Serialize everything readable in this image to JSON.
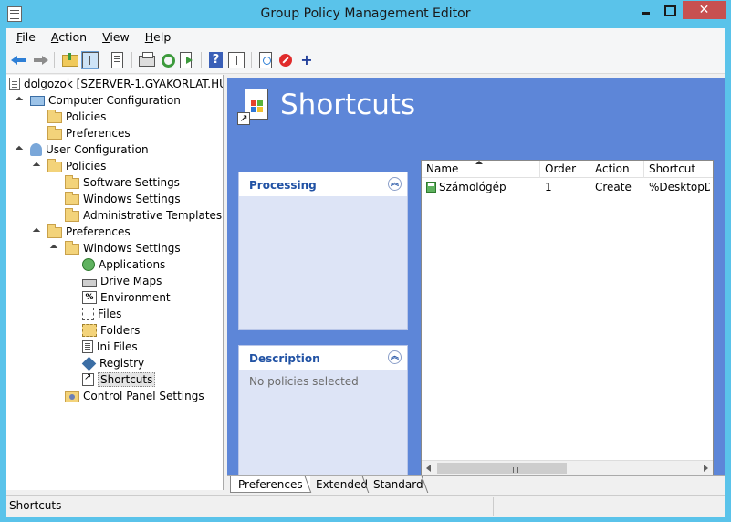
{
  "window": {
    "title": "Group Policy Management Editor",
    "close_label": "✕"
  },
  "menu": [
    {
      "label": "File",
      "key": "F",
      "rest": "ile"
    },
    {
      "label": "Action",
      "key": "A",
      "rest": "ction"
    },
    {
      "label": "View",
      "key": "V",
      "rest": "iew"
    },
    {
      "label": "Help",
      "key": "H",
      "rest": "elp"
    }
  ],
  "toolbar": {
    "help_glyph": "?",
    "add_glyph": "+"
  },
  "tree": {
    "root": "dolgozok [SZERVER-1.GYAKORLAT.HU]",
    "computer_config": "Computer Configuration",
    "cc_policies": "Policies",
    "cc_preferences": "Preferences",
    "user_config": "User Configuration",
    "uc_policies": "Policies",
    "software_settings": "Software Settings",
    "windows_settings_pol": "Windows Settings",
    "admin_templates": "Administrative Templates: Po",
    "uc_preferences": "Preferences",
    "windows_settings_pref": "Windows Settings",
    "applications": "Applications",
    "drive_maps": "Drive Maps",
    "environment": "Environment",
    "files": "Files",
    "folders": "Folders",
    "ini_files": "Ini Files",
    "registry": "Registry",
    "shortcuts": "Shortcuts",
    "control_panel": "Control Panel Settings",
    "env_glyph": "%"
  },
  "content": {
    "heading": "Shortcuts",
    "processing": {
      "title": "Processing"
    },
    "description": {
      "title": "Description",
      "body": "No policies selected"
    },
    "list": {
      "columns": [
        "Name",
        "Order",
        "Action",
        "Shortcut"
      ],
      "rows": [
        {
          "name": "Számológép",
          "order": "1",
          "action": "Create",
          "shortcut": "%DesktopDir%"
        }
      ]
    }
  },
  "tabs": [
    "Preferences",
    "Extended",
    "Standard"
  ],
  "status": {
    "text": "Shortcuts"
  },
  "colors": {
    "titlebar": "#5ac3ea",
    "content_bg": "#5d86d8",
    "panel_title": "#2152a4",
    "close": "#c75050"
  }
}
